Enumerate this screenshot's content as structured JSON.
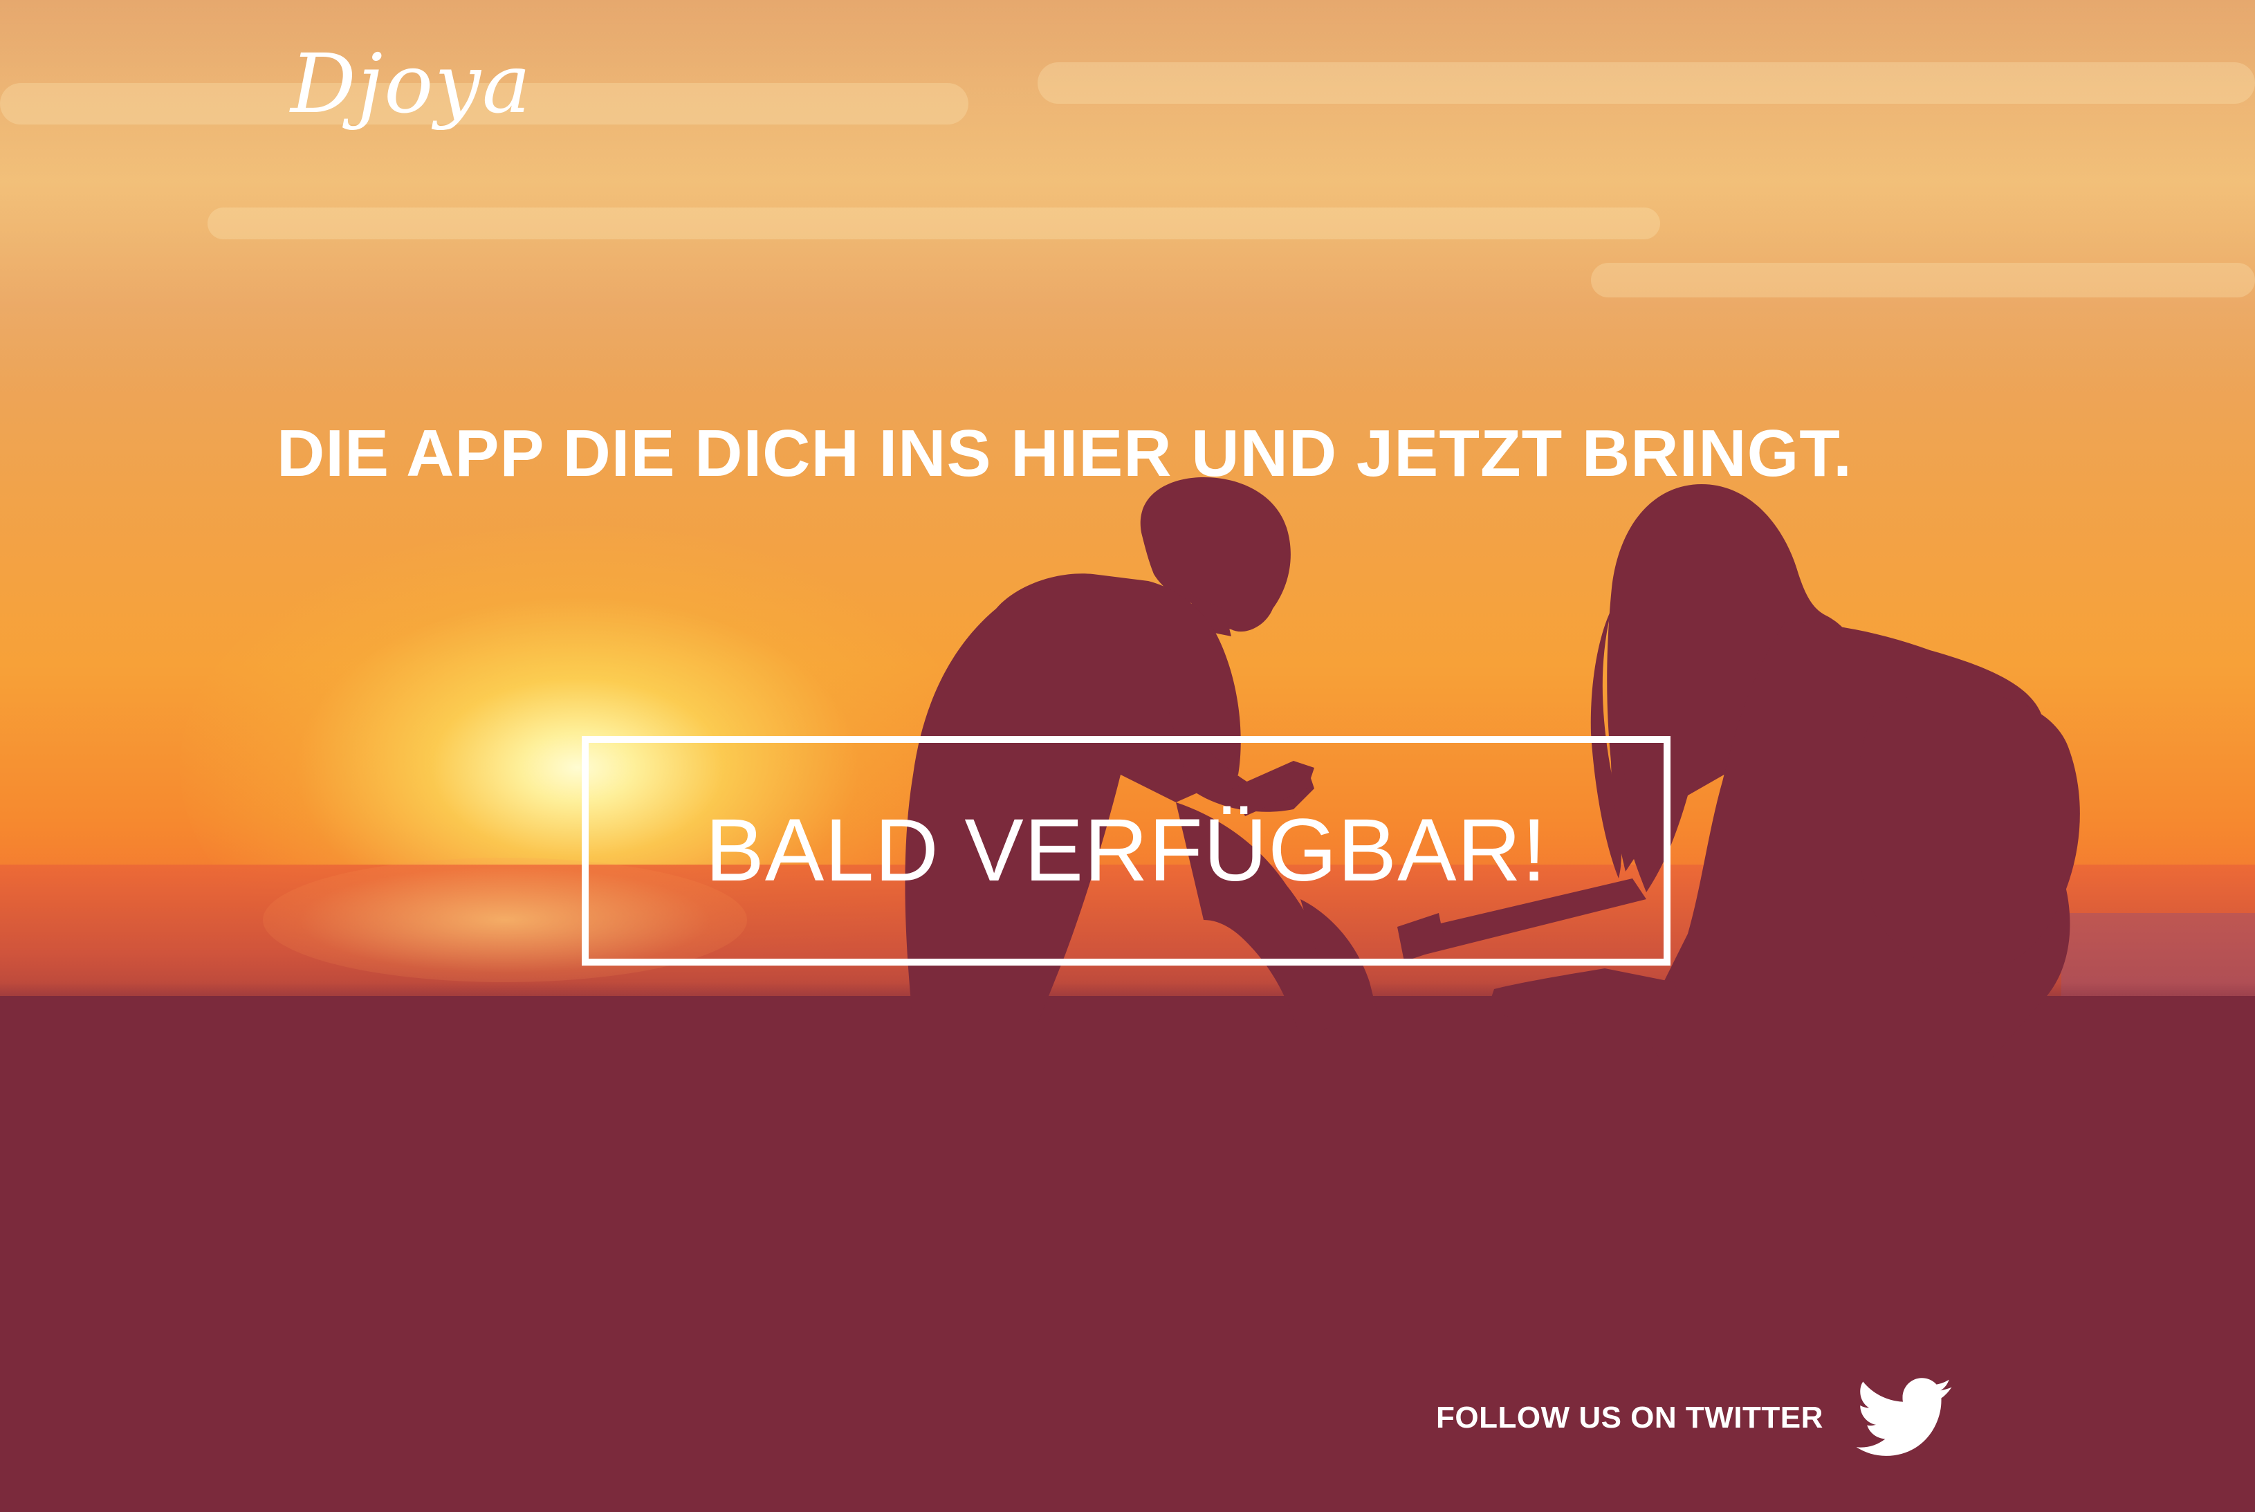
{
  "brand": {
    "logo_text": "Djoya"
  },
  "hero": {
    "headline": "DIE APP DIE DICH INS HIER UND JETZT BRINGT.",
    "cta_label": "BALD VERFÜGBAR!"
  },
  "social": {
    "label": "FOLLOW US ON TWITTER",
    "icon": "twitter-bird-icon"
  },
  "colors": {
    "overlay": "#7b2a3c",
    "text": "#ffffff",
    "sky_top": "#e6a561",
    "sky_mid": "#f7a138",
    "sun": "#fff7c8"
  }
}
